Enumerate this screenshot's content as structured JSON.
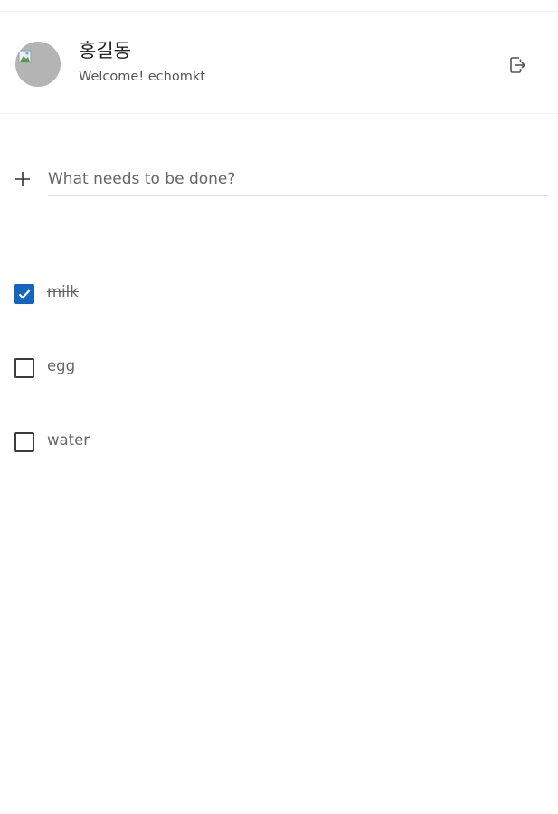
{
  "header": {
    "user_name": "홍길동",
    "welcome_text": "Welcome! echomkt",
    "avatar_icon": "broken-image-avatar",
    "logout_icon": "logout-icon"
  },
  "add_todo": {
    "icon": "plus-icon",
    "placeholder": "What needs to be done?",
    "value": ""
  },
  "todos": [
    {
      "text": "milk",
      "completed": true
    },
    {
      "text": "egg",
      "completed": false
    },
    {
      "text": "water",
      "completed": false
    }
  ],
  "colors": {
    "accent": "#1565c0",
    "text": "#555555",
    "divider": "#dcdcdc"
  }
}
